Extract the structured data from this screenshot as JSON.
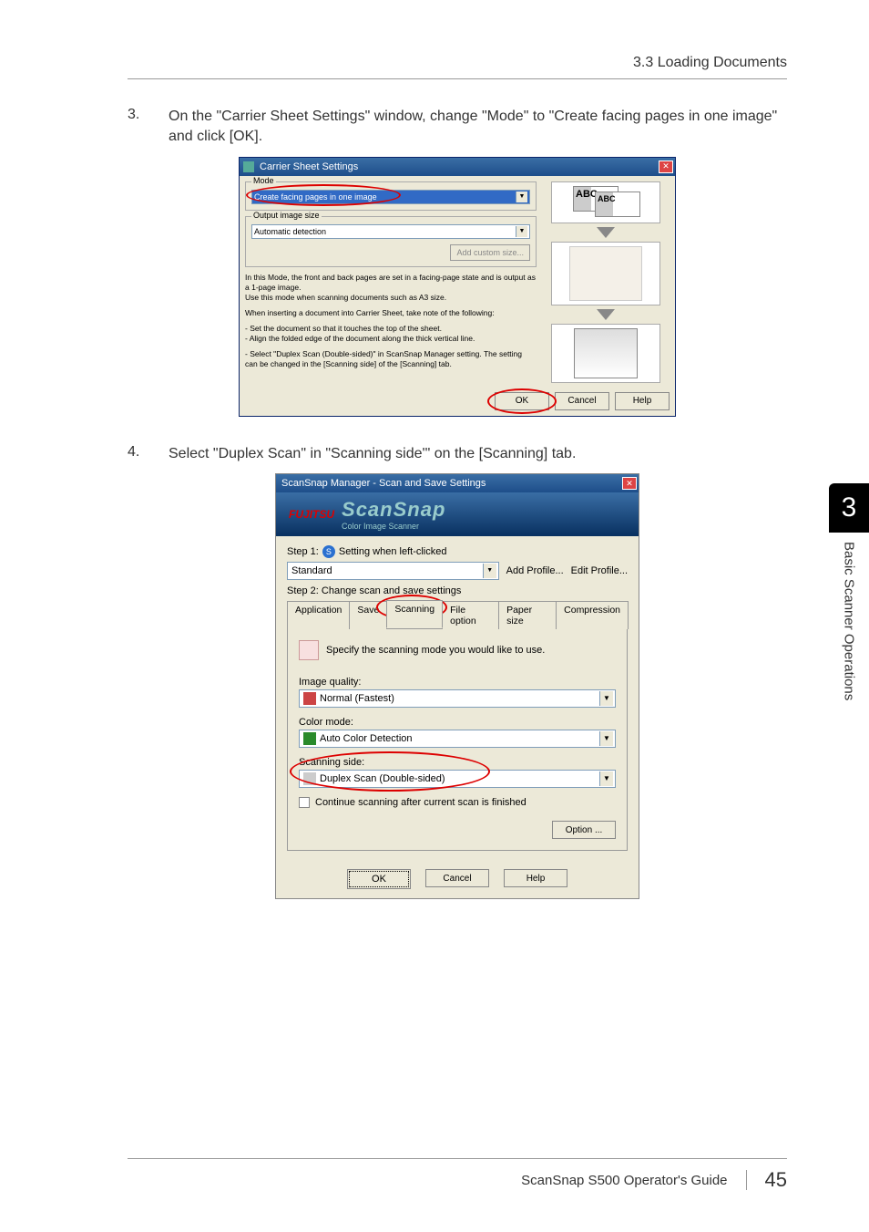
{
  "doc": {
    "section_header": "3.3 Loading Documents",
    "footer_title": "ScanSnap S500 Operator's Guide",
    "page_number": "45",
    "side_tab_num": "3",
    "side_tab_text": "Basic Scanner Operations"
  },
  "step3": {
    "num": "3.",
    "text": "On the \"Carrier Sheet Settings\" window, change \"Mode\" to \"Create facing pages in one image\" and click [OK]."
  },
  "step4": {
    "num": "4.",
    "text": "Select \"Duplex Scan\" in \"Scanning side'\" on the [Scanning] tab."
  },
  "carrier_dialog": {
    "title": "Carrier Sheet Settings",
    "mode_label": "Mode",
    "mode_value": "Create facing pages in one image",
    "output_label": "Output image size",
    "output_value": "Automatic detection",
    "add_custom": "Add custom size...",
    "info1": "In this Mode, the front and back pages are set in a facing-page state and is output as a 1-page image.\nUse this mode when scanning documents such as A3 size.",
    "info2": "When inserting a document into Carrier Sheet, take note of the following:",
    "info3": "- Set the document so that it touches the top of the sheet.\n- Align the folded edge of the document along the thick vertical line.",
    "info4": "- Select \"Duplex Scan (Double-sided)\" in ScanSnap Manager setting. The setting can be changed in the [Scanning side] of the [Scanning] tab.",
    "abc": "ABC",
    "ok": "OK",
    "cancel": "Cancel",
    "help": "Help"
  },
  "ssm_dialog": {
    "title": "ScanSnap Manager - Scan and Save Settings",
    "brand": "FUJITSU",
    "logo": "ScanSnap",
    "sublogo": "Color Image Scanner",
    "step1": "Step 1:",
    "step1_text": "Setting when left-clicked",
    "profile_value": "Standard",
    "add_profile": "Add Profile...",
    "edit_profile": "Edit Profile...",
    "step2": "Step 2: Change scan and save settings",
    "tabs": {
      "application": "Application",
      "save": "Save",
      "scanning": "Scanning",
      "file_option": "File option",
      "paper_size": "Paper size",
      "compression": "Compression"
    },
    "hint": "Specify the scanning mode you would like to use.",
    "image_quality_label": "Image quality:",
    "image_quality_value": "Normal (Fastest)",
    "color_mode_label": "Color mode:",
    "color_mode_value": "Auto Color Detection",
    "scanning_side_label": "Scanning side:",
    "scanning_side_value": "Duplex Scan (Double-sided)",
    "continue_chk": "Continue scanning after current scan is finished",
    "option_btn": "Option ...",
    "ok": "OK",
    "cancel": "Cancel",
    "help": "Help"
  }
}
